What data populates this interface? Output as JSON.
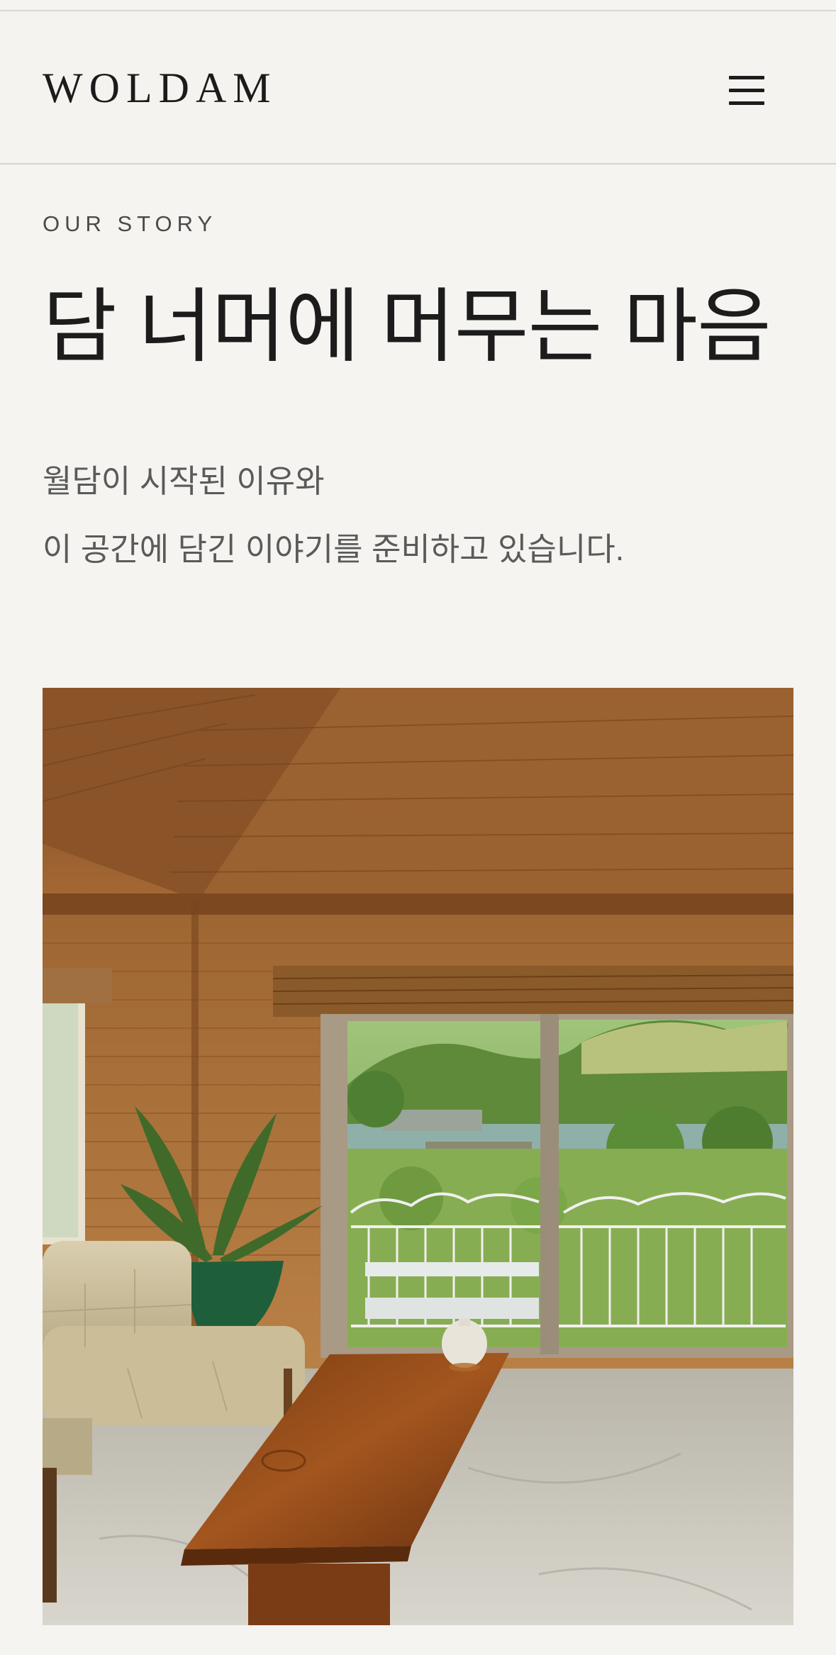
{
  "header": {
    "logo": "WOLDAM",
    "menu_icon": "hamburger-menu-icon"
  },
  "story": {
    "eyebrow": "OUR STORY",
    "title": "담 너머에 머무는 마음",
    "description_lines": [
      "월담이 시작된 이유와",
      "이 공간에 담긴 이야기를 준비하고 있습니다."
    ]
  },
  "photo": {
    "subject": "wood-paneled living room with sofa, coffee table and view of green hills and lake"
  },
  "colors": {
    "background": "#f5f4f1",
    "text_primary": "#1c1c1c",
    "text_secondary": "#5a5a5a",
    "divider": "#d5d3ce"
  }
}
